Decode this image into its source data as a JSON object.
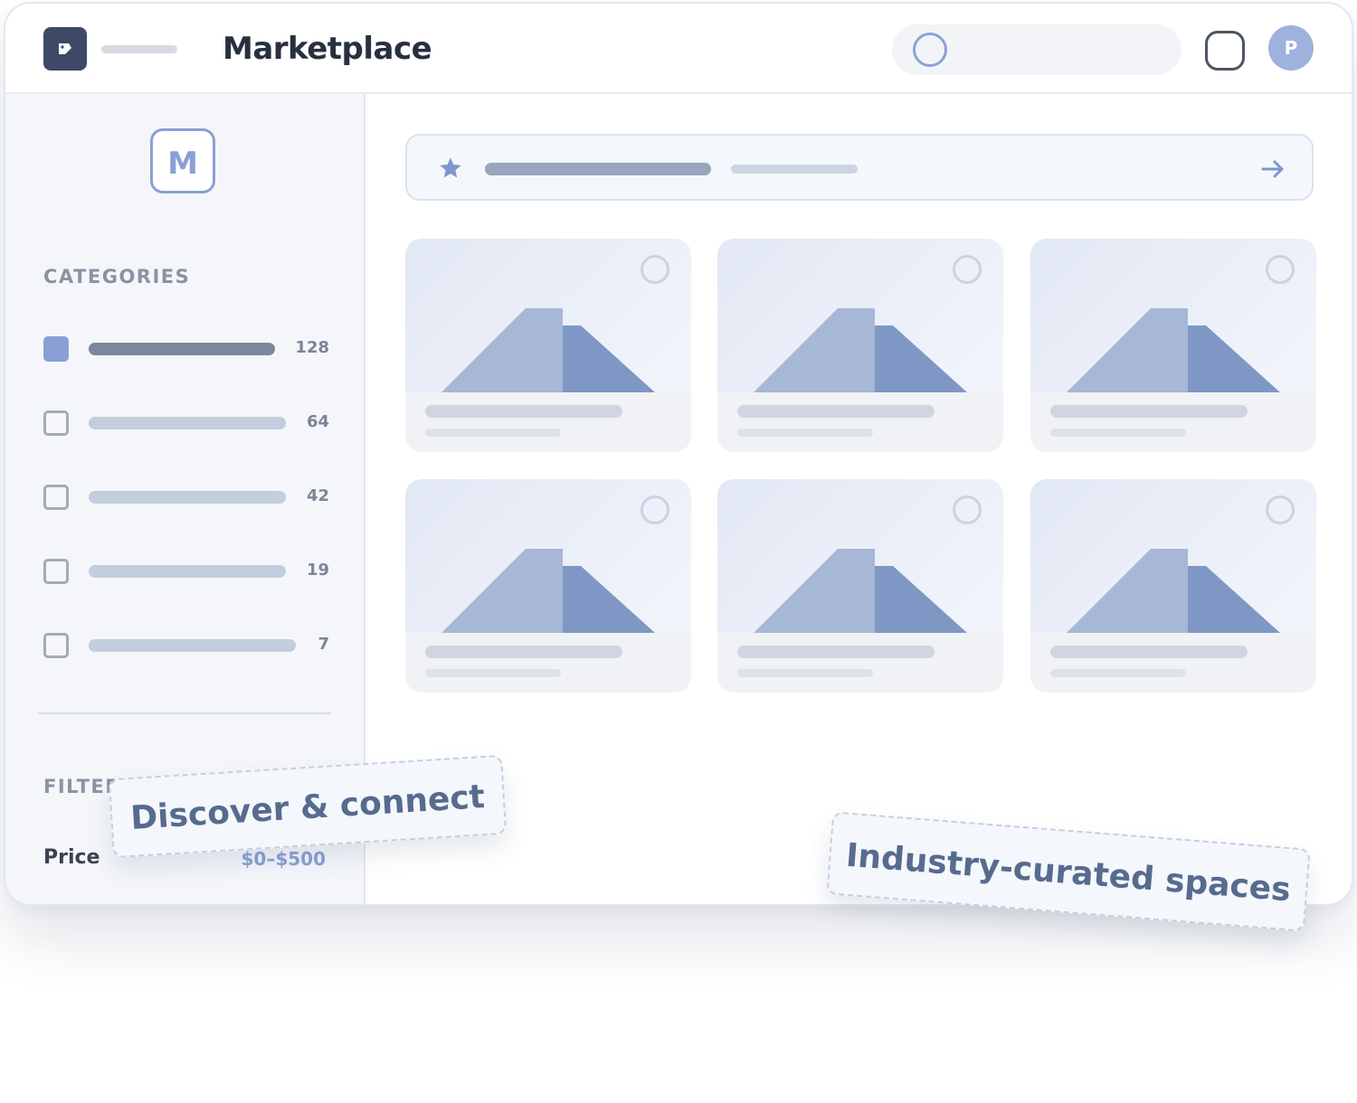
{
  "header": {
    "title": "Marketplace",
    "avatar_initial": "P",
    "icons": [
      "logo-icon",
      "search-icon",
      "bell-icon"
    ]
  },
  "sidebar": {
    "brand_initial": "M",
    "categories_label": "CATEGORIES",
    "categories": [
      {
        "count": "128",
        "checked": true
      },
      {
        "count": "64",
        "checked": false
      },
      {
        "count": "42",
        "checked": false
      },
      {
        "count": "19",
        "checked": false
      },
      {
        "count": "7",
        "checked": false
      }
    ],
    "filter_label": "FILTER",
    "price_label": "Price",
    "price_value": "$0–$500"
  },
  "main": {
    "promo": {
      "icon": "star-icon",
      "action_icon": "arrow-right-icon"
    },
    "cards": [
      {
        "fav_icon": "heart-outline-icon"
      },
      {
        "fav_icon": "heart-outline-icon"
      },
      {
        "fav_icon": "heart-outline-icon"
      },
      {
        "fav_icon": "heart-outline-icon"
      },
      {
        "fav_icon": "heart-outline-icon"
      },
      {
        "fav_icon": "heart-outline-icon"
      }
    ]
  },
  "tags": {
    "left": "Discover & connect",
    "right": "Industry-curated spaces"
  },
  "colors": {
    "accent": "#8aa0d4",
    "dark": "#3d4a66",
    "title": "#28303f"
  }
}
